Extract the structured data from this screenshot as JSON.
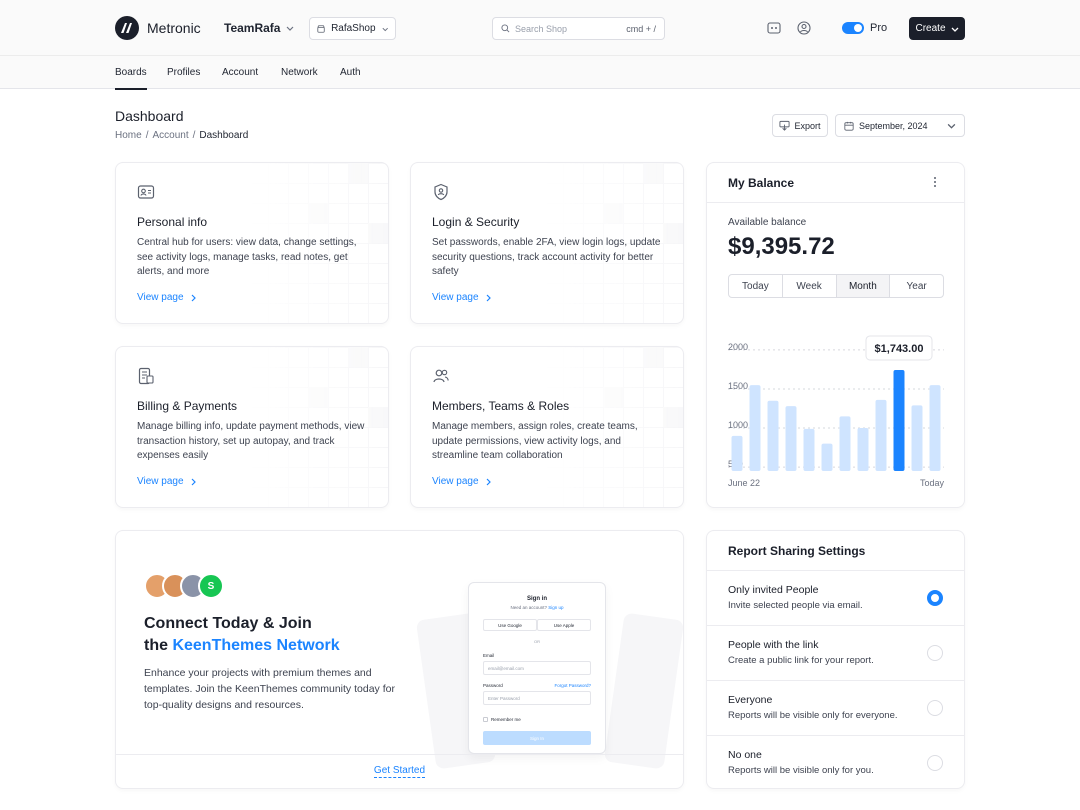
{
  "header": {
    "brand": "Metronic",
    "team": "TeamRafa",
    "shop": "RafaShop",
    "search_placeholder": "Search Shop",
    "search_shortcut": "cmd + /",
    "toggle_label": "Pro",
    "create_label": "Create"
  },
  "nav": {
    "items": [
      {
        "label": "Boards",
        "active": true
      },
      {
        "label": "Profiles"
      },
      {
        "label": "Account"
      },
      {
        "label": "Network"
      },
      {
        "label": "Auth"
      }
    ]
  },
  "page": {
    "title": "Dashboard",
    "breadcrumb": [
      "Home",
      "Account",
      "Dashboard"
    ],
    "export_label": "Export",
    "date_label": "September, 2024"
  },
  "feature_cards": [
    {
      "icon": "id-card-icon",
      "title": "Personal info",
      "desc": "Central hub for users: view data, change settings, see activity logs, manage tasks, read notes, get alerts, and more",
      "link": "View page"
    },
    {
      "icon": "shield-user-icon",
      "title": "Login & Security",
      "desc": "Set passwords, enable 2FA, view login logs, update security questions, track account activity for better safety",
      "link": "View page"
    },
    {
      "icon": "receipt-icon",
      "title": "Billing & Payments",
      "desc": "Manage billing info, update payment methods, view transaction history, set up autopay, and track expenses easily",
      "link": "View page"
    },
    {
      "icon": "users-icon",
      "title": "Members, Teams & Roles",
      "desc": "Manage members, assign roles, create teams, update permissions, view activity logs, and streamline team collaboration",
      "link": "View page"
    }
  ],
  "balance": {
    "title": "My Balance",
    "available_label": "Available balance",
    "amount": "$9,395.72",
    "periods": [
      "Today",
      "Week",
      "Month",
      "Year"
    ],
    "active_period": "Month",
    "tooltip": "$1,743.00"
  },
  "chart_data": {
    "type": "bar",
    "x_start_label": "June 22",
    "x_end_label": "Today",
    "y_ticks": [
      500,
      1000,
      1500,
      2000
    ],
    "ylim": [
      450,
      2050
    ],
    "values": [
      900,
      1550,
      1350,
      1280,
      990,
      800,
      1150,
      1000,
      1360,
      1743,
      1290,
      1550
    ],
    "highlight_index": 9,
    "grid": true,
    "colors": {
      "bar": "#cfe4ff",
      "highlight": "#1b84ff"
    }
  },
  "promo": {
    "avatar_initial": "S",
    "title_line1": "Connect Today & Join",
    "title_prefix": "the ",
    "title_accent": "KeenThemes Network",
    "desc": "Enhance your projects with premium themes and templates. Join the KeenThemes community today for top-quality designs and resources.",
    "cta": "Get Started",
    "mock": {
      "title": "Sign in",
      "sub_prefix": "Need an account?",
      "sub_link": "Sign up",
      "google": "Use Google",
      "apple": "Use Apple",
      "or": "OR",
      "email_label": "Email",
      "email_placeholder": "email@email.com",
      "password_label": "Password",
      "forgot": "Forgot Password?",
      "password_placeholder": "Enter Password",
      "remember": "Remember me",
      "submit": "Sign In"
    }
  },
  "report_sharing": {
    "title": "Report Sharing Settings",
    "options": [
      {
        "name": "Only invited People",
        "desc": "Invite selected people via email.",
        "selected": true
      },
      {
        "name": "People with the link",
        "desc": "Create a public link for your report.",
        "selected": false
      },
      {
        "name": "Everyone",
        "desc": "Reports will be visible only for everyone.",
        "selected": false
      },
      {
        "name": "No one",
        "desc": "Reports will be visible only for you.",
        "selected": false
      }
    ]
  }
}
